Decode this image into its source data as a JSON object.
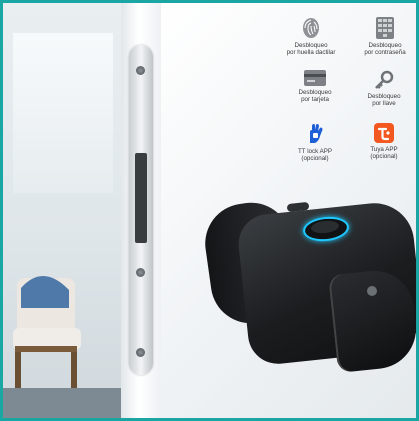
{
  "features": [
    {
      "icon": "fingerprint-icon",
      "line1": "Desbloqueo",
      "line2": "por huella dactilar"
    },
    {
      "icon": "keypad-icon",
      "line1": "Desbloqueo",
      "line2": "por contraseña"
    },
    {
      "icon": "card-icon",
      "line1": "Desbloqueo",
      "line2": "por tarjeta"
    },
    {
      "icon": "key-icon",
      "line1": "Desbloqueo",
      "line2": "por llave"
    },
    {
      "icon": "tt-lock-app-icon",
      "line1": "TT lock APP",
      "line2": "(opcional)"
    },
    {
      "icon": "tuya-app-icon",
      "line1": "Tuya APP",
      "line2": "(opcional)"
    }
  ],
  "colors": {
    "frame_border": "#1aa6a2",
    "fingerprint_ring": "#1ec8ff",
    "tt_lock_blue": "#1e5fd8",
    "tuya_orange": "#f2581f"
  }
}
